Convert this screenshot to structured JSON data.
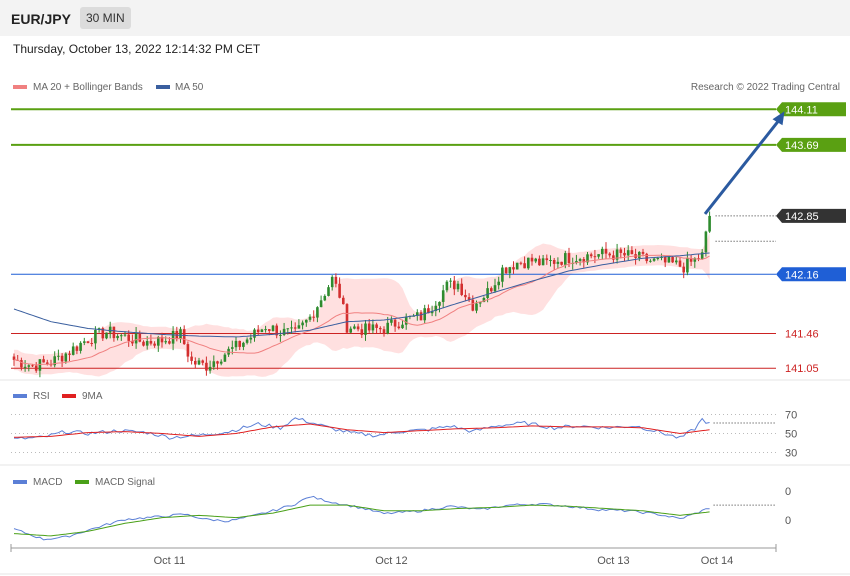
{
  "header": {
    "pair": "EUR/JPY",
    "timeframe": "30 MIN"
  },
  "datetime": "Thursday, October 13, 2022 12:14:32 PM CET",
  "credit": "Research © 2022 Trading Central",
  "colors": {
    "up": "#2e8b2e",
    "down": "#d32f2f",
    "ma20": "#f08080",
    "band": "#ffd6d6",
    "ma50": "#3a5f9f",
    "target": "#5aa012",
    "pivot": "#1f5fd6",
    "support": "#cc2222",
    "current": "#333333",
    "arrow": "#2b5aa0",
    "rsi": "#5b7fd6",
    "rsi_ma": "#e02020",
    "macd": "#5b7fd6",
    "macd_signal": "#4aa018"
  },
  "chart_data": [
    {
      "type": "candlestick",
      "panel": "price",
      "legend": [
        "MA 20 + Bollinger Bands",
        "MA 50"
      ],
      "ylim": [
        140.97,
        144.22
      ],
      "x_ticks": [
        {
          "label": "Oct 11",
          "index": 42
        },
        {
          "label": "Oct 12",
          "index": 102
        },
        {
          "label": "Oct 13",
          "index": 162
        },
        {
          "label": "Oct 14",
          "index": 190
        }
      ],
      "levels": [
        {
          "value": 144.11,
          "label": "144.11",
          "role": "target"
        },
        {
          "value": 143.69,
          "label": "143.69",
          "role": "target"
        },
        {
          "value": 142.85,
          "label": "142.85",
          "role": "current"
        },
        {
          "value": 142.16,
          "label": "142.16",
          "role": "pivot"
        },
        {
          "value": 141.46,
          "label": "141.46",
          "role": "support"
        },
        {
          "value": 141.05,
          "label": "141.05",
          "role": "support"
        }
      ],
      "arrow": {
        "from_index": 190,
        "from_value": 142.85,
        "to_index": 205,
        "to_value": 144.11
      },
      "close_anchors": [
        [
          0,
          141.15
        ],
        [
          5,
          141.08
        ],
        [
          10,
          141.12
        ],
        [
          15,
          141.25
        ],
        [
          20,
          141.4
        ],
        [
          25,
          141.48
        ],
        [
          30,
          141.42
        ],
        [
          35,
          141.36
        ],
        [
          40,
          141.38
        ],
        [
          45,
          141.45
        ],
        [
          48,
          141.12
        ],
        [
          52,
          141.08
        ],
        [
          56,
          141.2
        ],
        [
          60,
          141.3
        ],
        [
          64,
          141.42
        ],
        [
          68,
          141.55
        ],
        [
          72,
          141.48
        ],
        [
          76,
          141.45
        ],
        [
          80,
          141.65
        ],
        [
          84,
          141.95
        ],
        [
          86,
          142.1
        ],
        [
          88,
          141.92
        ],
        [
          90,
          141.55
        ],
        [
          95,
          141.5
        ],
        [
          100,
          141.52
        ],
        [
          105,
          141.62
        ],
        [
          110,
          141.66
        ],
        [
          113,
          141.8
        ],
        [
          117,
          142.02
        ],
        [
          120,
          142.05
        ],
        [
          124,
          141.8
        ],
        [
          128,
          141.95
        ],
        [
          132,
          142.22
        ],
        [
          136,
          142.3
        ],
        [
          140,
          142.32
        ],
        [
          143,
          142.28
        ],
        [
          146,
          142.32
        ],
        [
          150,
          142.36
        ],
        [
          155,
          142.38
        ],
        [
          160,
          142.4
        ],
        [
          166,
          142.38
        ],
        [
          172,
          142.32
        ],
        [
          178,
          142.28
        ],
        [
          181,
          142.25
        ],
        [
          183,
          142.3
        ],
        [
          186,
          142.38
        ],
        [
          187,
          142.62
        ],
        [
          188,
          142.85
        ]
      ],
      "ma50_anchors": [
        [
          0,
          141.75
        ],
        [
          10,
          141.6
        ],
        [
          20,
          141.52
        ],
        [
          30,
          141.48
        ],
        [
          40,
          141.45
        ],
        [
          50,
          141.43
        ],
        [
          60,
          141.42
        ],
        [
          70,
          141.45
        ],
        [
          80,
          141.5
        ],
        [
          90,
          141.6
        ],
        [
          100,
          141.62
        ],
        [
          110,
          141.68
        ],
        [
          120,
          141.82
        ],
        [
          130,
          141.95
        ],
        [
          140,
          142.08
        ],
        [
          150,
          142.2
        ],
        [
          160,
          142.28
        ],
        [
          170,
          142.35
        ],
        [
          180,
          142.38
        ],
        [
          190,
          142.42
        ]
      ]
    },
    {
      "type": "line",
      "panel": "rsi",
      "legend": [
        "RSI",
        "9MA"
      ],
      "ylim": [
        20,
        80
      ],
      "y_ticks": [
        70,
        50,
        30
      ],
      "series": [
        {
          "name": "RSI",
          "anchors": [
            [
              0,
              44
            ],
            [
              8,
              46
            ],
            [
              14,
              52
            ],
            [
              20,
              50
            ],
            [
              28,
              53
            ],
            [
              36,
              51
            ],
            [
              42,
              46
            ],
            [
              50,
              48
            ],
            [
              58,
              52
            ],
            [
              66,
              60
            ],
            [
              72,
              56
            ],
            [
              76,
              66
            ],
            [
              80,
              62
            ],
            [
              86,
              55
            ],
            [
              92,
              50
            ],
            [
              98,
              48
            ],
            [
              104,
              52
            ],
            [
              112,
              54
            ],
            [
              118,
              58
            ],
            [
              124,
              52
            ],
            [
              130,
              58
            ],
            [
              138,
              61
            ],
            [
              146,
              56
            ],
            [
              152,
              58
            ],
            [
              160,
              56
            ],
            [
              168,
              58
            ],
            [
              174,
              52
            ],
            [
              180,
              45
            ],
            [
              184,
              55
            ],
            [
              186,
              65
            ],
            [
              188,
              60
            ]
          ]
        },
        {
          "name": "9MA",
          "anchors": [
            [
              0,
              46
            ],
            [
              10,
              47
            ],
            [
              20,
              51
            ],
            [
              30,
              52
            ],
            [
              40,
              50
            ],
            [
              50,
              47
            ],
            [
              60,
              50
            ],
            [
              70,
              57
            ],
            [
              80,
              60
            ],
            [
              90,
              54
            ],
            [
              100,
              51
            ],
            [
              110,
              53
            ],
            [
              120,
              55
            ],
            [
              130,
              56
            ],
            [
              140,
              58
            ],
            [
              150,
              57
            ],
            [
              160,
              57
            ],
            [
              170,
              56
            ],
            [
              180,
              50
            ],
            [
              188,
              54
            ]
          ]
        }
      ]
    },
    {
      "type": "line",
      "panel": "macd",
      "legend": [
        "MACD",
        "MACD Signal"
      ],
      "ylim": [
        -0.5,
        0.5
      ],
      "y_ticks": [
        "0",
        "0"
      ],
      "series": [
        {
          "name": "MACD",
          "anchors": [
            [
              0,
              -0.22
            ],
            [
              8,
              -0.4
            ],
            [
              14,
              -0.36
            ],
            [
              22,
              -0.2
            ],
            [
              30,
              -0.05
            ],
            [
              40,
              0
            ],
            [
              46,
              0.04
            ],
            [
              52,
              -0.05
            ],
            [
              58,
              -0.08
            ],
            [
              64,
              0
            ],
            [
              70,
              0.1
            ],
            [
              76,
              0.22
            ],
            [
              80,
              0.35
            ],
            [
              86,
              0.25
            ],
            [
              94,
              0.15
            ],
            [
              100,
              0.05
            ],
            [
              110,
              0.1
            ],
            [
              118,
              0.18
            ],
            [
              126,
              0.12
            ],
            [
              134,
              0.2
            ],
            [
              142,
              0.22
            ],
            [
              150,
              0.18
            ],
            [
              158,
              0.12
            ],
            [
              166,
              0.1
            ],
            [
              174,
              0.04
            ],
            [
              180,
              -0.04
            ],
            [
              184,
              0.05
            ],
            [
              188,
              0.15
            ]
          ]
        },
        {
          "name": "MACD Signal",
          "anchors": [
            [
              0,
              -0.3
            ],
            [
              10,
              -0.34
            ],
            [
              20,
              -0.26
            ],
            [
              30,
              -0.12
            ],
            [
              40,
              -0.02
            ],
            [
              50,
              0.02
            ],
            [
              60,
              -0.02
            ],
            [
              70,
              0.06
            ],
            [
              80,
              0.2
            ],
            [
              90,
              0.2
            ],
            [
              100,
              0.1
            ],
            [
              110,
              0.1
            ],
            [
              120,
              0.14
            ],
            [
              130,
              0.16
            ],
            [
              140,
              0.2
            ],
            [
              150,
              0.18
            ],
            [
              160,
              0.14
            ],
            [
              170,
              0.1
            ],
            [
              180,
              0.02
            ],
            [
              188,
              0.08
            ]
          ]
        }
      ]
    }
  ]
}
